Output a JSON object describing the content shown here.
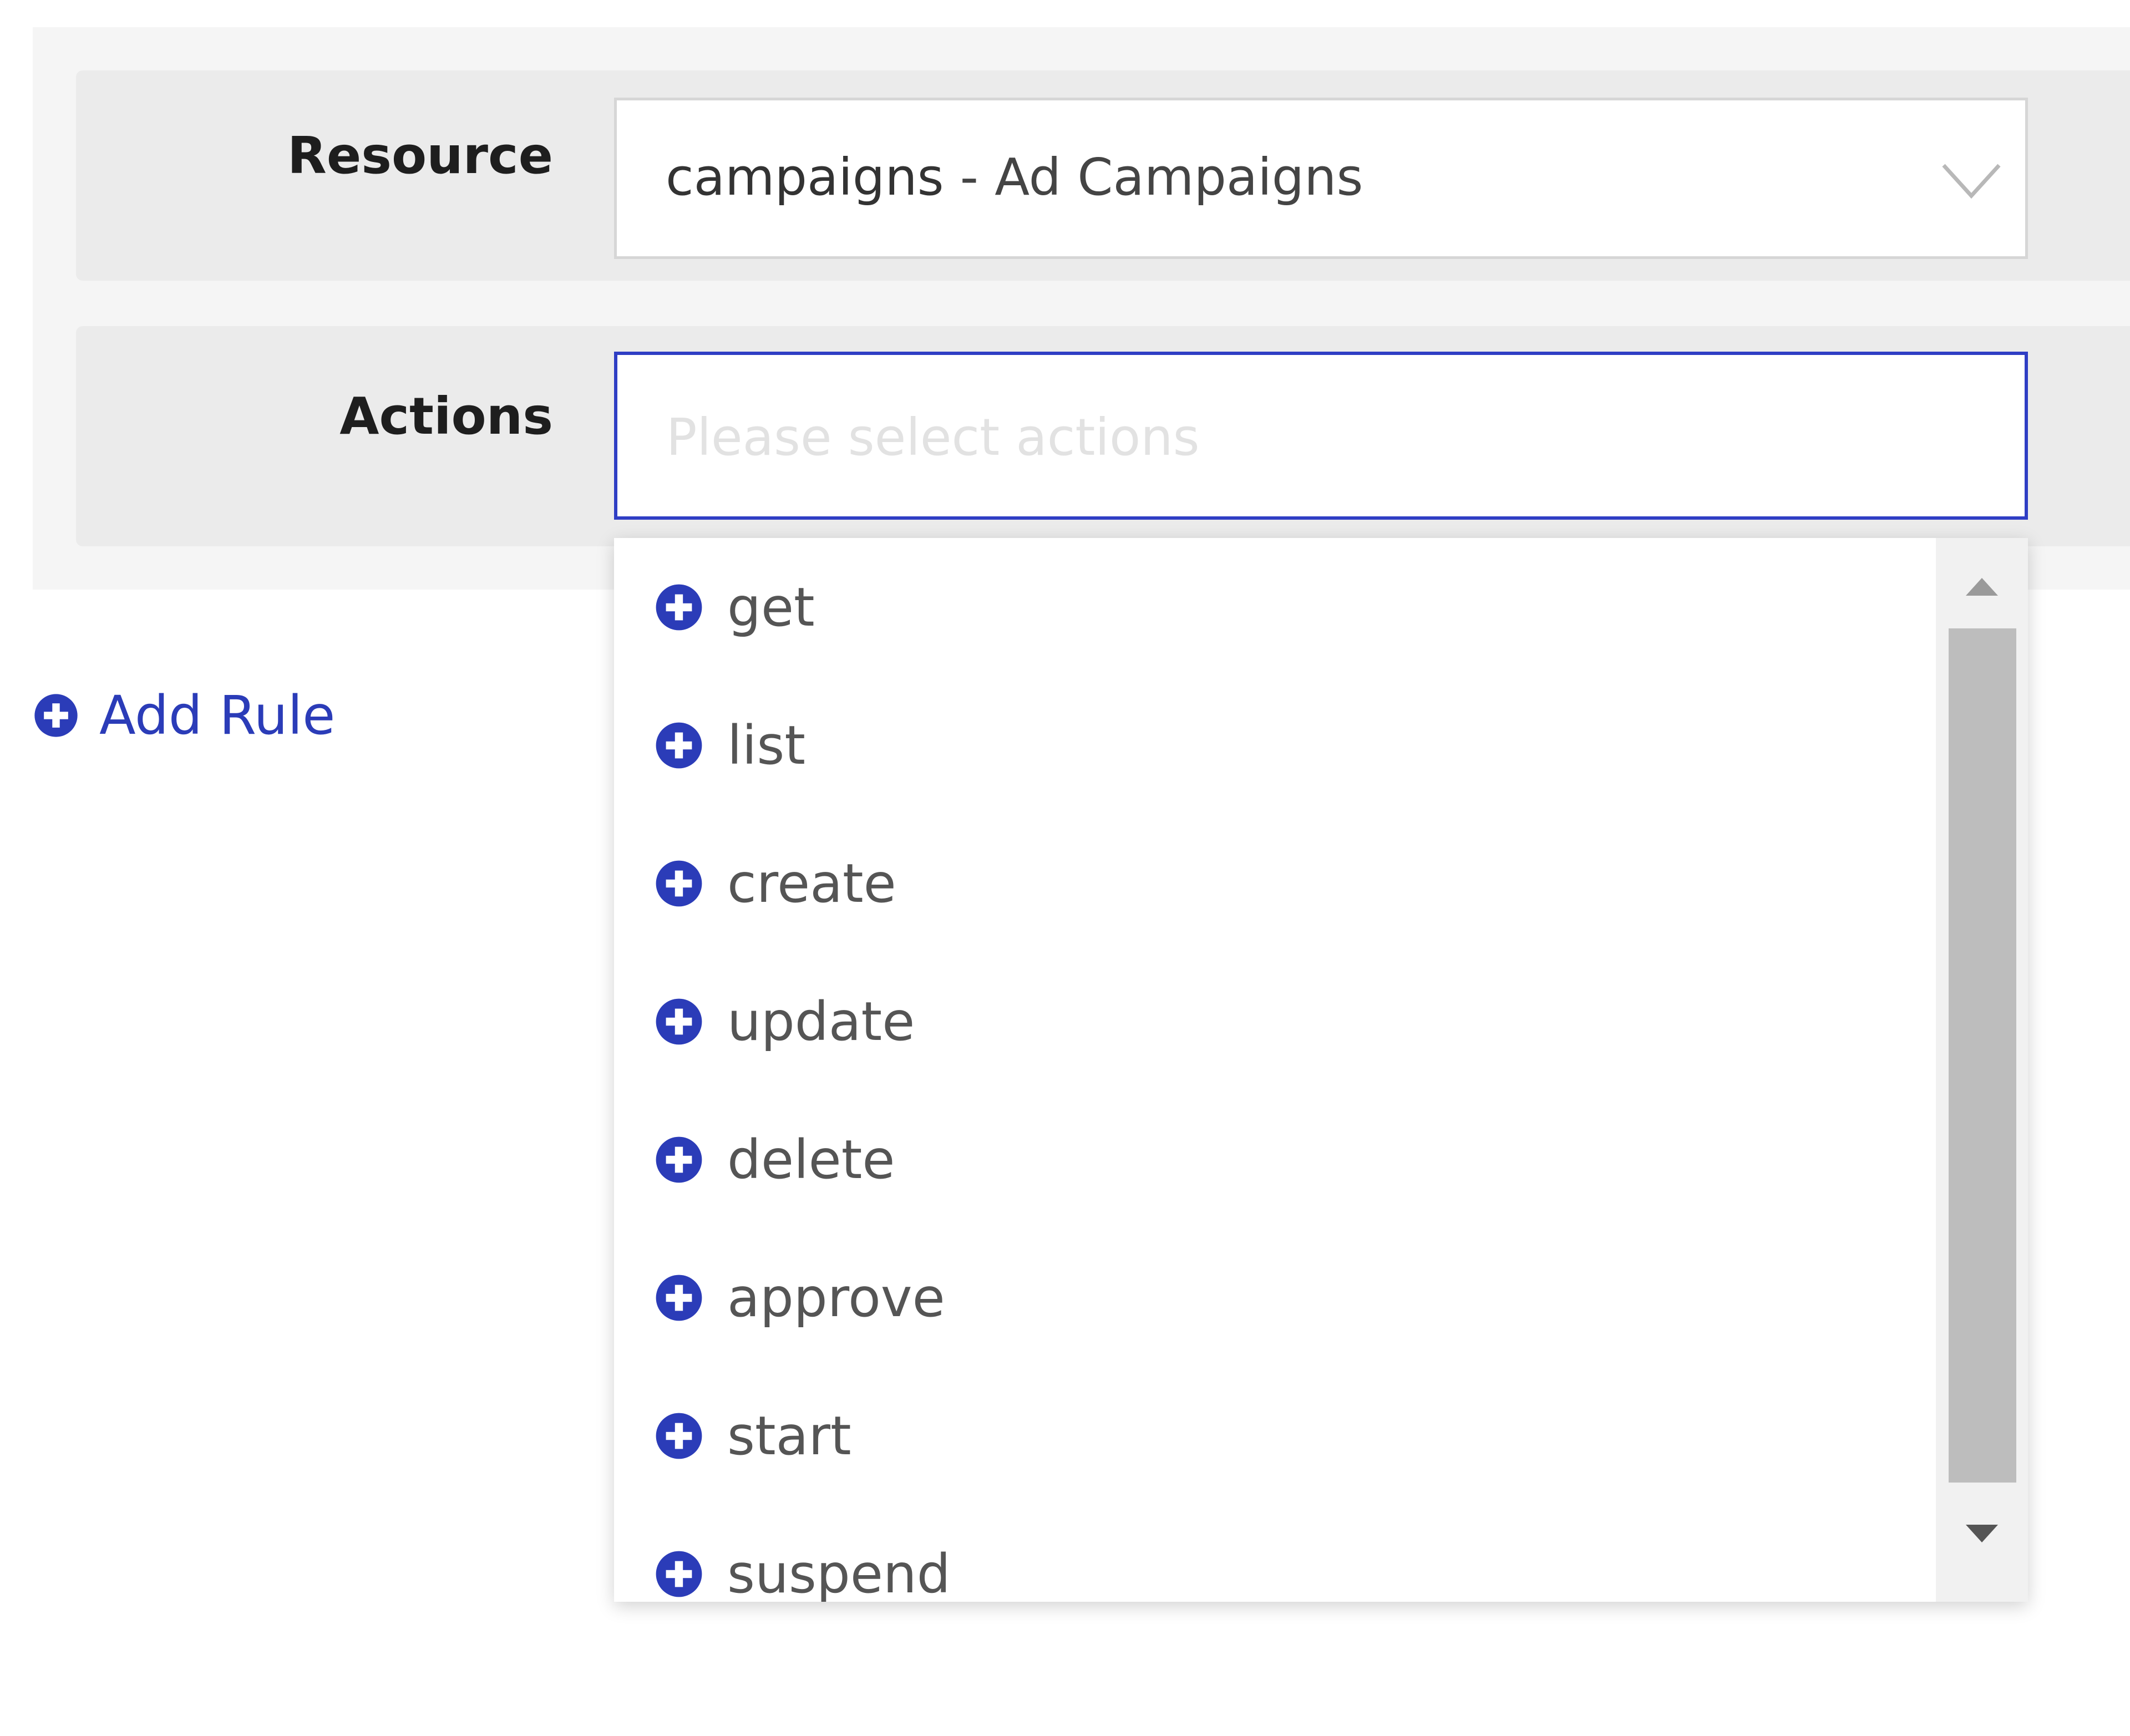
{
  "form": {
    "resource_label": "Resource",
    "resource_value": {
      "name": "campaigns",
      "separator": " - ",
      "description": "Ad Campaigns"
    },
    "actions_label": "Actions",
    "actions_placeholder": "Please select actions"
  },
  "add_rule_label": "Add Rule",
  "dropdown": {
    "options": [
      {
        "label": "get"
      },
      {
        "label": "list"
      },
      {
        "label": "create"
      },
      {
        "label": "update"
      },
      {
        "label": "delete"
      },
      {
        "label": "approve"
      },
      {
        "label": "start"
      },
      {
        "label": "suspend"
      }
    ]
  },
  "colors": {
    "accent": "#2b3cb8",
    "focus_border": "#2f3ec4",
    "panel_bg": "#f5f5f5",
    "row_bg": "#ebebeb",
    "scroll_thumb": "#bdbdbd"
  },
  "icons": {
    "option": "plus-circle-icon",
    "add_rule": "plus-circle-icon",
    "select": "chevron-down-icon"
  }
}
